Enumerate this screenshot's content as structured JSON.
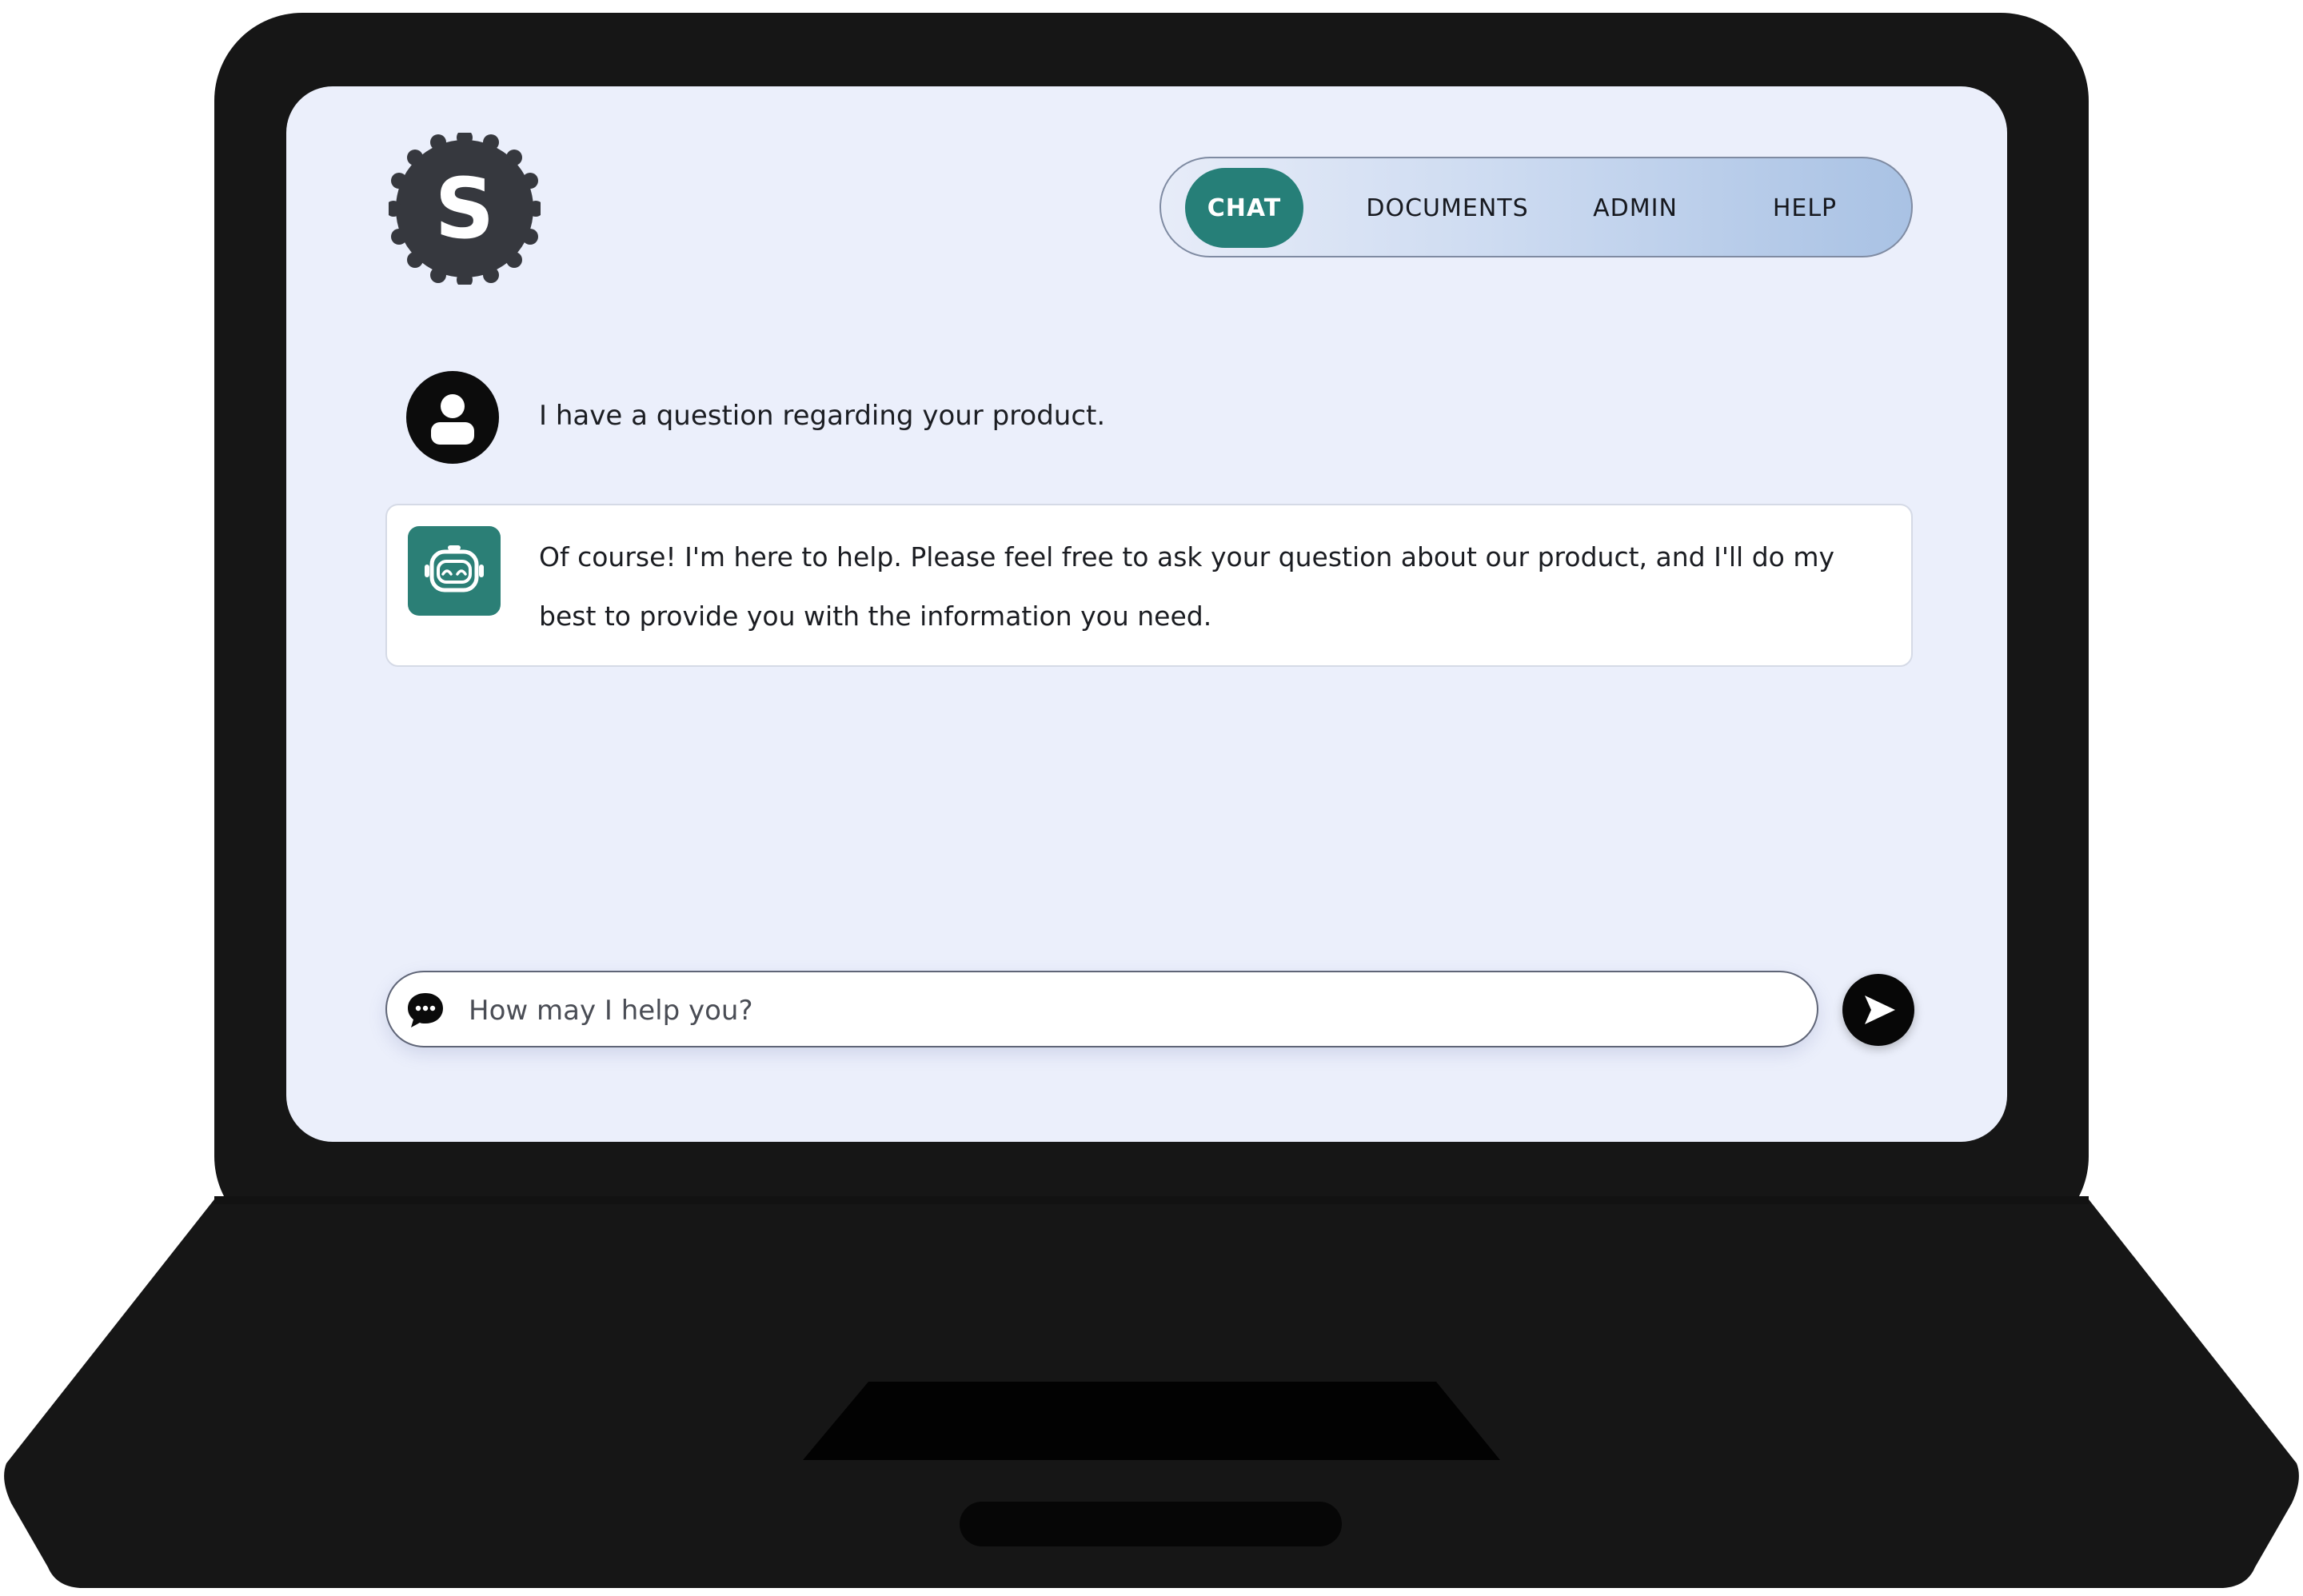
{
  "logo": {
    "letter": "S"
  },
  "nav": {
    "tabs": [
      {
        "label": "CHAT",
        "active": true
      },
      {
        "label": "DOCUMENTS",
        "active": false
      },
      {
        "label": "ADMIN",
        "active": false
      },
      {
        "label": "HELP",
        "active": false
      }
    ]
  },
  "conversation": {
    "messages": [
      {
        "role": "user",
        "text": "I have a question regarding your product."
      },
      {
        "role": "assistant",
        "text": "Of course! I'm here to help. Please feel free to ask your question about our product, and I'll do my best to provide you with the information you need."
      }
    ]
  },
  "composer": {
    "placeholder": "How may I help you?",
    "value": ""
  },
  "colors": {
    "accent": "#267f78",
    "screen_background": "#ebeffb",
    "laptop_body": "#161616"
  },
  "icons": {
    "logo": "badge-logo-icon",
    "user_avatar": "user-avatar-icon",
    "bot_avatar": "robot-icon",
    "composer": "chat-bubble-icon",
    "send": "send-arrow-icon"
  }
}
